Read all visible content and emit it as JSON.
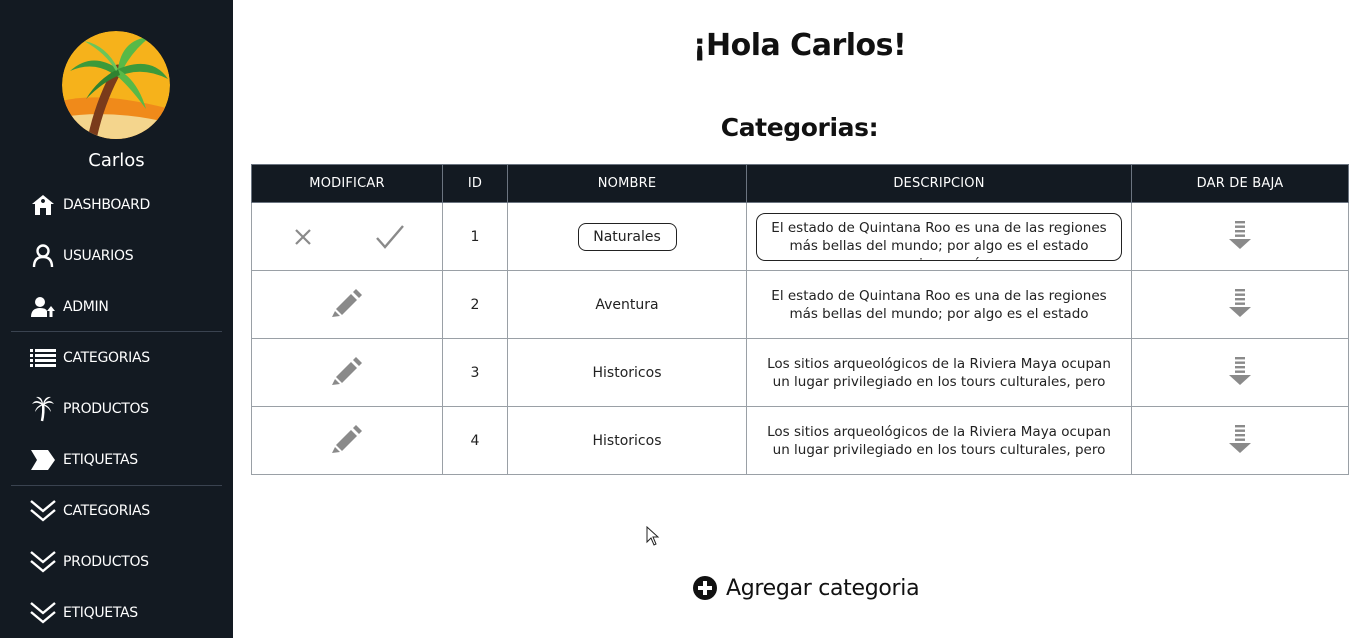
{
  "sidebar": {
    "username": "Carlos",
    "items": [
      {
        "label": "DASHBOARD",
        "icon": "home-icon"
      },
      {
        "label": "USUARIOS",
        "icon": "user-icon"
      },
      {
        "label": "ADMIN",
        "icon": "admin-user-icon"
      },
      {
        "label": "CATEGORIAS",
        "icon": "list-icon"
      },
      {
        "label": "PRODUCTOS",
        "icon": "palm-tree-icon"
      },
      {
        "label": "ETIQUETAS",
        "icon": "tag-icon"
      },
      {
        "label": "CATEGORIAS",
        "icon": "double-chevron-down-icon"
      },
      {
        "label": "PRODUCTOS",
        "icon": "double-chevron-down-icon"
      },
      {
        "label": "ETIQUETAS",
        "icon": "double-chevron-down-icon"
      }
    ]
  },
  "main": {
    "greeting": "¡Hola Carlos!",
    "section_title": "Categorias:",
    "table": {
      "headers": [
        "MODIFICAR",
        "ID",
        "NOMBRE",
        "DESCRIPCION",
        "DAR DE BAJA"
      ],
      "rows": [
        {
          "id": "1",
          "nombre": "Naturales",
          "descripcion": "El estado de Quintana Roo es una de las regiones más bellas del mundo; por algo es el estado mexicano más",
          "editing": true
        },
        {
          "id": "2",
          "nombre": "Aventura",
          "descripcion": "El estado de Quintana Roo es una de las regiones más bellas del mundo; por algo es el estado mexicano más",
          "editing": false
        },
        {
          "id": "3",
          "nombre": "Historicos",
          "descripcion": "Los sitios arqueológicos de la Riviera Maya ocupan un lugar privilegiado en los tours culturales, pero no son",
          "editing": false
        },
        {
          "id": "4",
          "nombre": "Historicos",
          "descripcion": "Los sitios arqueológicos de la Riviera Maya ocupan un lugar privilegiado en los tours culturales, pero no son",
          "editing": false
        }
      ]
    },
    "add_button_label": "Agregar categoria"
  },
  "colors": {
    "sidebar_bg": "#131a22",
    "table_header_bg": "#131a22",
    "icon_gray": "#8a8a8a"
  }
}
